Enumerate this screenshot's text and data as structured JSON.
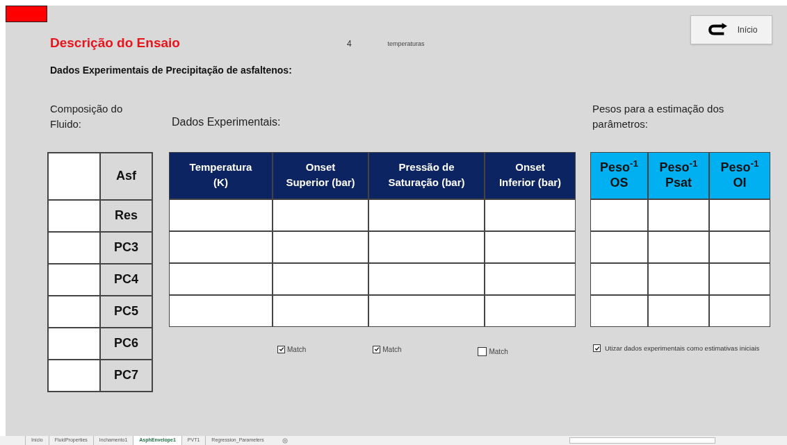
{
  "title": "Descrição do Ensaio",
  "count": "4",
  "count_unit": "temperaturas",
  "home_button": "Início",
  "subtitle": "Dados Experimentais de Precipitação de asfaltenos:",
  "composition": {
    "label": "Composição do Fluido:",
    "rows": [
      "Asf",
      "Res",
      "PC3",
      "PC4",
      "PC5",
      "PC6",
      "PC7"
    ]
  },
  "experimental": {
    "label": "Dados Experimentais:",
    "columns": [
      {
        "lines": [
          "Temperatura",
          "(K)"
        ]
      },
      {
        "lines": [
          "Onset",
          "Superior (bar)"
        ]
      },
      {
        "lines": [
          "Pressão de",
          "Saturação (bar)"
        ]
      },
      {
        "lines": [
          "Onset",
          "Inferior (bar)"
        ]
      }
    ],
    "match_options": [
      {
        "label": "Match",
        "checked": true
      },
      {
        "label": "Match",
        "checked": true
      },
      {
        "label": "Match",
        "checked": false
      }
    ]
  },
  "weights": {
    "label": "Pesos para a estimação dos parâmetros:",
    "columns": [
      {
        "lines": [
          "Peso$^{-1}$",
          "OS"
        ]
      },
      {
        "lines": [
          "Peso$^{-1}$",
          "Psat"
        ]
      },
      {
        "lines": [
          "Peso$^{-1}$",
          "OI"
        ]
      }
    ],
    "initial_estimates": {
      "label": "Utizar dados experimentais como estimativas iniciais",
      "checked": true
    }
  },
  "sheet_tabs": [
    {
      "label": "Início",
      "selected": false
    },
    {
      "label": "FluidProperties",
      "selected": false
    },
    {
      "label": "Inchamento1",
      "selected": false
    },
    {
      "label": "AsphEnvelope1",
      "selected": true
    },
    {
      "label": "PVT1",
      "selected": false
    },
    {
      "label": "Regression_Parameters",
      "selected": false
    }
  ]
}
